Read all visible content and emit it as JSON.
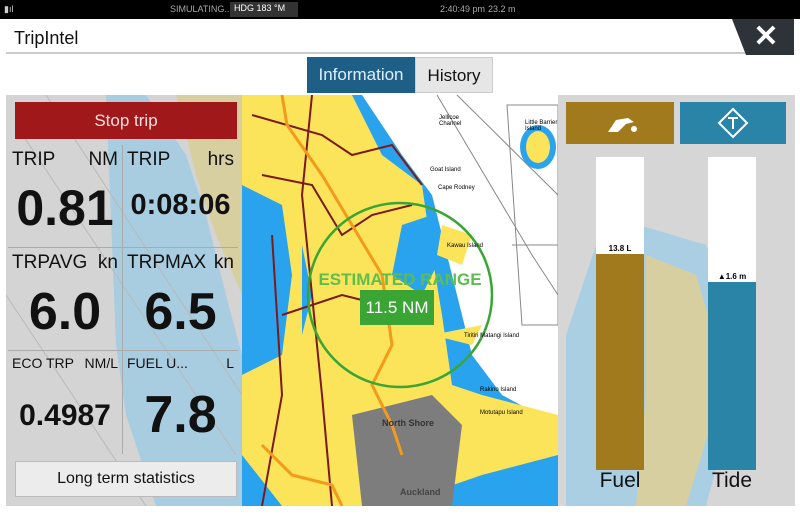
{
  "status": {
    "left": "SIMULATING...",
    "heading": "HDG 183 °M",
    "time": "2:40:49 pm",
    "depth": "23.2 m"
  },
  "header": {
    "title": "TripIntel",
    "close": "✕"
  },
  "tabs": [
    {
      "label": "Information",
      "active": true
    },
    {
      "label": "History",
      "active": false
    }
  ],
  "left": {
    "stop_label": "Stop trip",
    "cells": [
      {
        "label": "TRIP",
        "unit": "NM",
        "value": "0.81"
      },
      {
        "label": "TRIP",
        "unit": "hrs",
        "value": "0:08:06"
      },
      {
        "label": "TRPAVG",
        "unit": "kn",
        "value": "6.0"
      },
      {
        "label": "TRPMAX",
        "unit": "kn",
        "value": "6.5"
      },
      {
        "label": "ECO TRP",
        "unit": "NM/L",
        "value": "0.4987"
      },
      {
        "label": "FUEL U...",
        "unit": "L",
        "value": "7.8"
      }
    ],
    "long_term_label": "Long term statistics"
  },
  "map": {
    "range_title": "ESTIMATED RANGE",
    "range_value": "11.5 NM",
    "places": [
      "Jellicoe Channel",
      "Little Barrier Island",
      "Goat Island",
      "Cape Rodney",
      "Kawau Island",
      "Tiritiri Matangi Island",
      "North Shore",
      "Auckland",
      "Rakino Island",
      "Motutapu Island"
    ]
  },
  "right": {
    "fuel": {
      "icon": "fuel-nozzle-icon",
      "color": "#a07a1c",
      "name": "Fuel",
      "value": "13.8 L",
      "level": 0.69
    },
    "tide": {
      "icon": "tide-diamond-icon",
      "color": "#2a84a8",
      "name": "Tide",
      "value": "▲1.6 m",
      "level": 0.6
    }
  }
}
